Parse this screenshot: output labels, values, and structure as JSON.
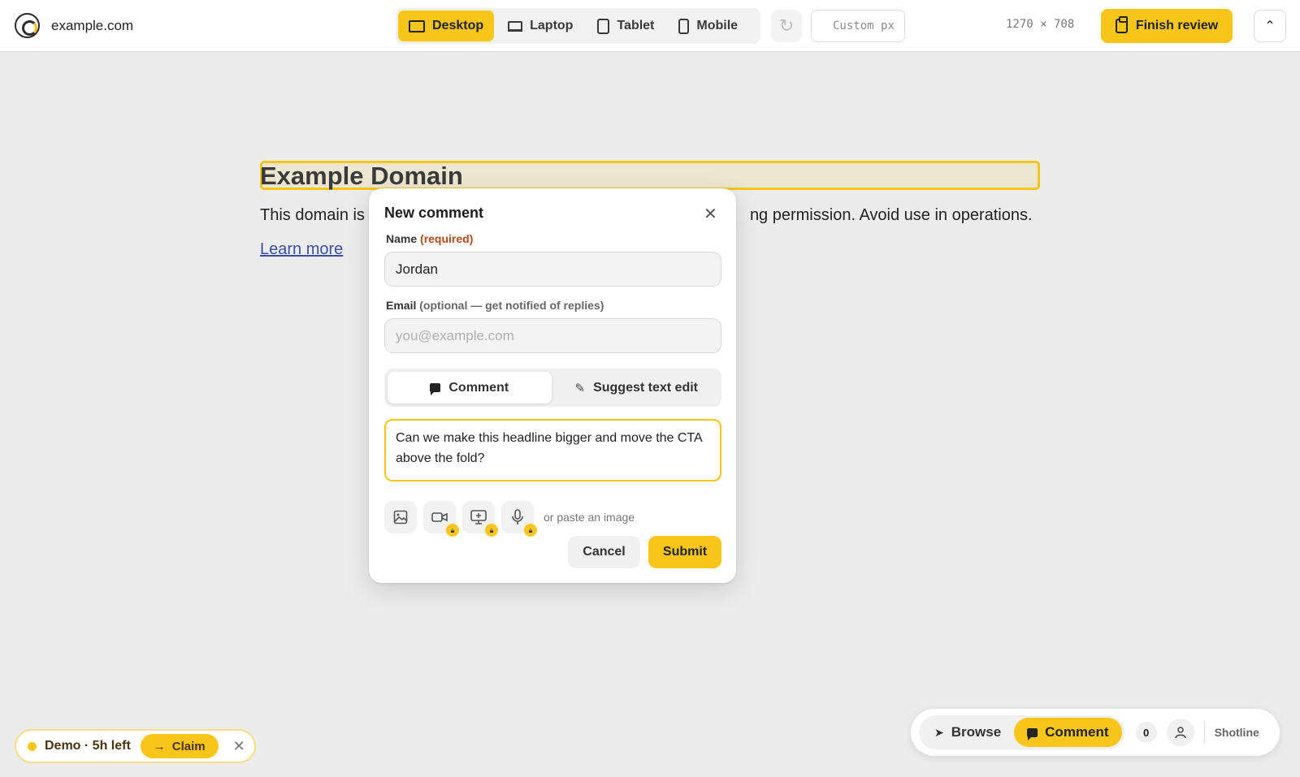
{
  "site": {
    "domain": "example.com"
  },
  "devices": [
    {
      "label": "Desktop",
      "icon": "desktop-icon",
      "active": true
    },
    {
      "label": "Laptop",
      "icon": "laptop-icon",
      "active": false
    },
    {
      "label": "Tablet",
      "icon": "tablet-icon",
      "active": false
    },
    {
      "label": "Mobile",
      "icon": "mobile-icon",
      "active": false
    }
  ],
  "toolbar": {
    "custom_placeholder": "Custom",
    "custom_unit": "px",
    "dimensions": "1270 × 708",
    "finish_label": "Finish review"
  },
  "page": {
    "title": "Example Domain",
    "paragraph_start": "This domain is",
    "paragraph_end": "ng permission. Avoid use in operations.",
    "link": "Learn more"
  },
  "dialog": {
    "title": "New comment",
    "name_label": "Name",
    "name_required": "(required)",
    "name_value": "Jordan",
    "email_label": "Email",
    "email_hint": "(optional — get notified of replies)",
    "email_placeholder": "you@example.com",
    "tab_comment": "Comment",
    "tab_suggest": "Suggest text edit",
    "comment_text": "Can we make this headline bigger and move the CTA above the fold?",
    "paste_hint": "or paste an image",
    "cancel": "Cancel",
    "submit": "Submit"
  },
  "demo": {
    "text": "Demo · 5h left",
    "claim": "Claim"
  },
  "modebar": {
    "browse": "Browse",
    "comment": "Comment",
    "count": "0",
    "brand": "Shotline"
  },
  "colors": {
    "accent": "#f7c619",
    "required": "#b24a1a",
    "link": "#3b4fa0"
  }
}
